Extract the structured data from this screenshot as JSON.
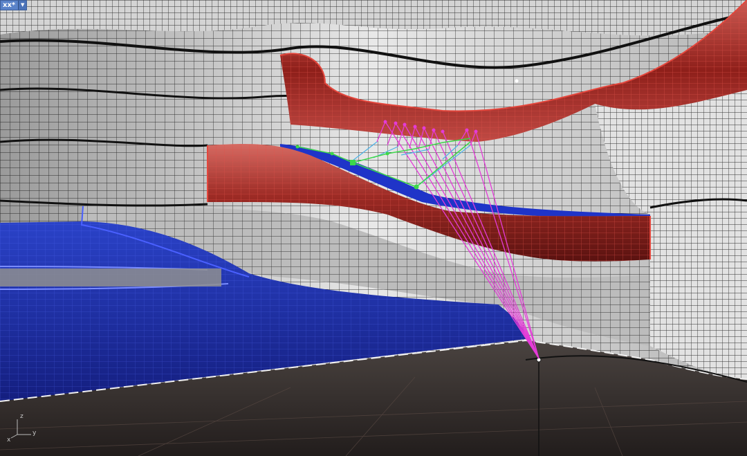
{
  "viewport": {
    "name": "xx*",
    "menu_icon": "triangle-down-icon"
  },
  "axes_widget": {
    "x_label": "x",
    "y_label": "y",
    "z_label": "z"
  },
  "colors": {
    "selection_red": "#b8312c",
    "selection_blue": "#1c2fb8",
    "control_magenta": "#e43bd8",
    "control_green": "#3cd84a",
    "control_cyan": "#4cb2e8",
    "surface_wire": "#111111",
    "ground": "#2c2625",
    "tab_bg": "#5a83c9"
  }
}
